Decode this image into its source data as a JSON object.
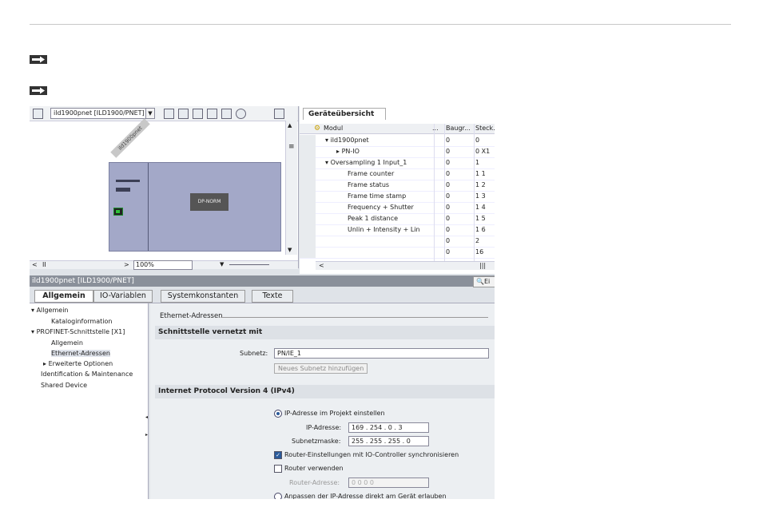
{
  "doc": {
    "arrow1": "arrow-right-icon",
    "arrow2": "arrow-right-icon"
  },
  "network_view": {
    "device_combo": "ild1900pnet [ILD1900/PNET]",
    "device_rotated_label": "ild1900pnet",
    "module_label": "DP-NORM",
    "zoom": "100%",
    "page_indicator": "II"
  },
  "device_overview": {
    "tab": "Geräteübersicht",
    "columns": [
      "Modul",
      "...",
      "Baugr...",
      "Steck..."
    ],
    "rows": [
      {
        "name": "ild1900pnet",
        "rack": "0",
        "slot": "0"
      },
      {
        "name": "PN-IO",
        "rack": "0",
        "slot": "0 X1"
      },
      {
        "name": "Oversampling 1 Input_1",
        "rack": "0",
        "slot": "1"
      },
      {
        "name": "Frame counter",
        "rack": "0",
        "slot": "1 1"
      },
      {
        "name": "Frame status",
        "rack": "0",
        "slot": "1 2"
      },
      {
        "name": "Frame time stamp",
        "rack": "0",
        "slot": "1 3"
      },
      {
        "name": "Frequency + Shutter",
        "rack": "0",
        "slot": "1 4"
      },
      {
        "name": "Peak 1 distance",
        "rack": "0",
        "slot": "1 5"
      },
      {
        "name": "Unlin + Intensity + Lin",
        "rack": "0",
        "slot": "1 6"
      },
      {
        "name": "",
        "rack": "0",
        "slot": "2"
      },
      {
        "name": "",
        "rack": "0",
        "slot": "16"
      }
    ]
  },
  "properties": {
    "title": "ild1900pnet [ILD1900/PNET]",
    "header_button": "Ei",
    "tabs": [
      "Allgemein",
      "IO-Variablen",
      "Systemkonstanten",
      "Texte"
    ],
    "nav": [
      "Allgemein",
      "Kataloginformation",
      "PROFINET-Schnittstelle [X1]",
      "Allgemein",
      "Ethernet-Adressen",
      "Erweiterte Optionen",
      "Identification & Maintenance",
      "Shared Device"
    ],
    "breadcrumb": "Ethernet-Adressen",
    "section1": "Schnittstelle vernetzt mit",
    "subnet_label": "Subnetz:",
    "subnet_value": "PN/IE_1",
    "add_subnet_btn": "Neues Subnetz hinzufügen",
    "section2": "Internet Protocol Version 4 (IPv4)",
    "radio_project": "IP-Adresse im Projekt einstellen",
    "ip_label": "IP-Adresse:",
    "ip_value": "169 . 254 . 0    . 3",
    "mask_label": "Subnetzmaske:",
    "mask_value": "255 . 255 . 255 . 0",
    "cb_sync": "Router-Einstellungen mit IO-Controller synchronisieren",
    "cb_router": "Router verwenden",
    "router_label": "Router-Adresse:",
    "router_value": "0      0      0      0",
    "radio_device": "Anpassen der IP-Adresse direkt am Gerät erlauben"
  }
}
